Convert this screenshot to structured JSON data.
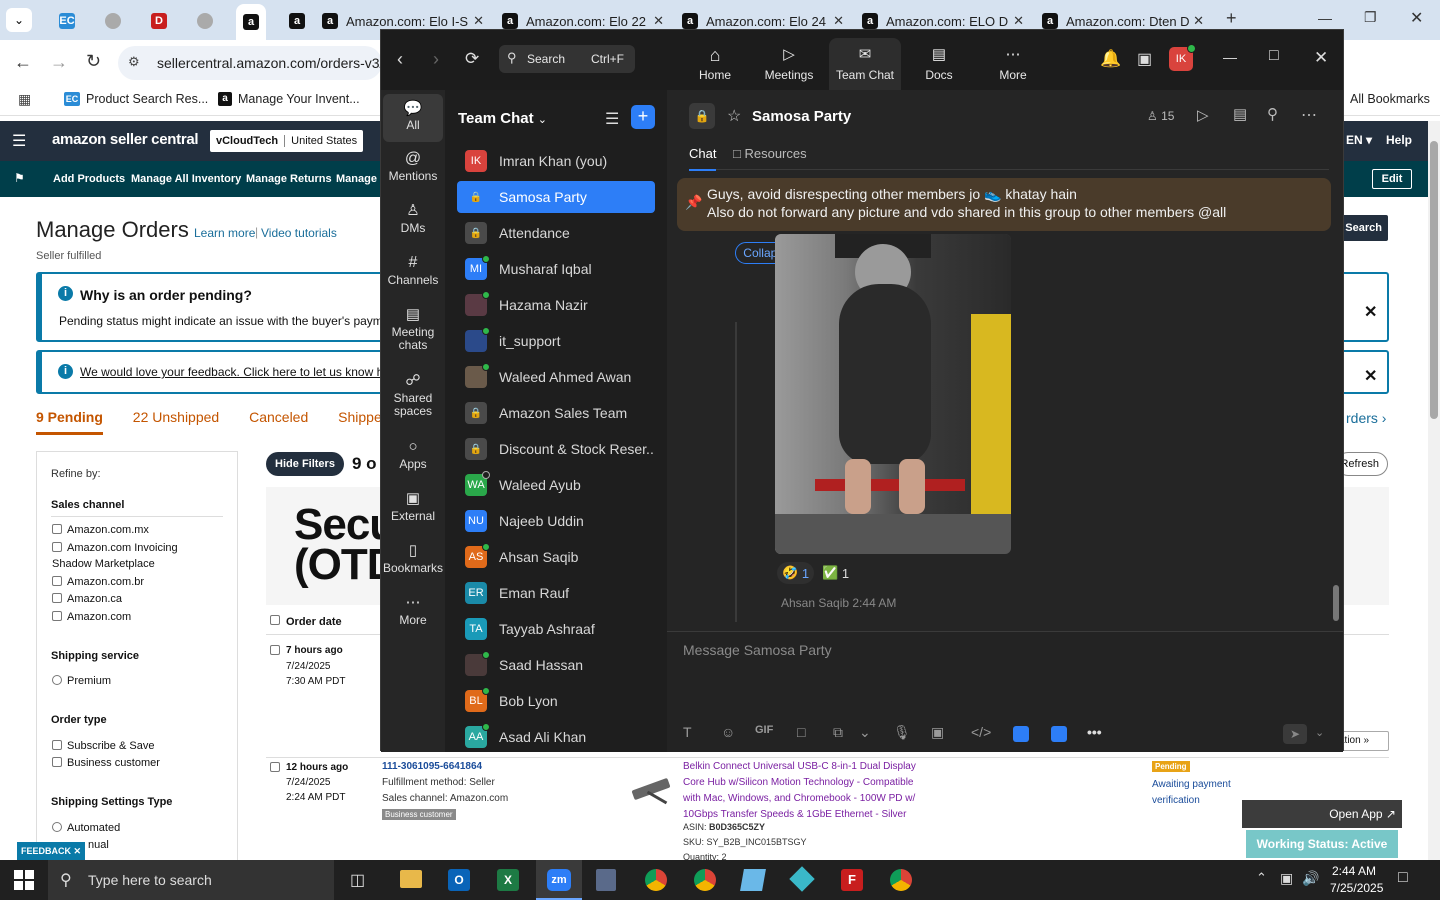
{
  "browser": {
    "tabs": [
      {
        "label": "",
        "icon": "ec-icon"
      },
      {
        "label": "",
        "icon": "generic-icon"
      },
      {
        "label": "",
        "icon": "dell-icon"
      },
      {
        "label": "",
        "icon": "generic-icon"
      },
      {
        "label": "",
        "icon": "amazon-icon"
      },
      {
        "label": "",
        "icon": "amazon-icon"
      },
      {
        "label": "Amazon.com: Elo I-S",
        "icon": "amazon-icon"
      },
      {
        "label": "Amazon.com: Elo 22",
        "icon": "amazon-icon"
      },
      {
        "label": "Amazon.com: Elo 24",
        "icon": "amazon-icon"
      },
      {
        "label": "Amazon.com: ELO D",
        "icon": "amazon-icon"
      },
      {
        "label": "Amazon.com: Dten D",
        "icon": "amazon-icon"
      }
    ],
    "url": "sellercentral.amazon.com/orders-v3/",
    "bookmarks": [
      "Product Search Res...",
      "Manage Your Invent..."
    ],
    "all_bookmarks": "All Bookmarks"
  },
  "seller": {
    "brand": "amazon seller central",
    "account": "vCloudTech",
    "marketplace": "United States",
    "lang": "EN",
    "help": "Help",
    "nav": [
      "Add Products",
      "Manage All Inventory",
      "Manage Returns",
      "Manage C"
    ],
    "edit": "Edit",
    "page_title": "Manage Orders",
    "learn_more": "Learn more",
    "video_tutorials": "Video tutorials",
    "fulfilled": "Seller fulfilled",
    "pending_title": "Why is an order pending?",
    "pending_text": "Pending status might indicate an issue with the buyer's paymen",
    "feedback_link": "We would love your feedback. Click here to let us know how",
    "search": "Search",
    "status_tabs": [
      "9 Pending",
      "22 Unshipped",
      "Canceled",
      "Shipped"
    ],
    "orders_link": "rders ›",
    "refine": "Refine by:",
    "sales_channel": "Sales channel",
    "channels": [
      "Amazon.com.mx",
      "Amazon.com Invoicing",
      "Shadow Marketplace",
      "Amazon.com.br",
      "Amazon.ca",
      "Amazon.com"
    ],
    "shipping_service": "Shipping service",
    "premium": "Premium",
    "order_type": "Order type",
    "order_types": [
      "Subscribe & Save",
      "Business customer"
    ],
    "ship_settings": "Shipping Settings Type",
    "ship_types": [
      "Automated",
      "nual"
    ],
    "hide_filters": "Hide Filters",
    "count": "9 o",
    "refresh": "Refresh",
    "banner": "Secu\n(OTD",
    "order_date": "Order date",
    "row1": {
      "ago": "7 hours ago",
      "date": "7/24/2025",
      "time": "7:30 AM PDT"
    },
    "row2": {
      "ago": "12 hours ago",
      "date": "7/24/2025",
      "time": "2:24 AM PDT",
      "order_id": "111-3061095-6641864",
      "method": "Fulfillment method: Seller",
      "channel": "Sales channel: Amazon.com",
      "badge": "Business customer",
      "product": "Belkin Connect Universal USB-C 8-in-1 Dual Display Core Hub w/Silicon Motion Technology - Compatible with Mac, Windows, and Chromebook - 100W PD w/ 10Gbps Transfer Speeds & 1GbE Ethernet - Silver",
      "asin_label": "ASIN:",
      "asin": "B0D365C5ZY",
      "sku": "SKU: SY_B2B_INC015BTSGY",
      "qty": "Quantity: 2",
      "status_badge": "Pending",
      "status_text": "Awaiting payment verification"
    },
    "action": "ation »",
    "feedback_tab": "FEEDBACK ✕",
    "open_app": "Open App ↗",
    "working_status": "Working Status: Active"
  },
  "zoom": {
    "search_label": "Search",
    "search_shortcut": "Ctrl+F",
    "nav": [
      {
        "label": "Home",
        "icon": "home-icon"
      },
      {
        "label": "Meetings",
        "icon": "video-icon"
      },
      {
        "label": "Team Chat",
        "icon": "chat-icon"
      },
      {
        "label": "Docs",
        "icon": "doc-icon"
      },
      {
        "label": "More",
        "icon": "more-icon"
      }
    ],
    "avatar": "IK",
    "rail": [
      "All",
      "Mentions",
      "DMs",
      "Channels",
      "Meeting chats",
      "Shared spaces",
      "Apps",
      "External",
      "Bookmarks",
      "More"
    ],
    "list_title": "Team Chat",
    "contacts": [
      {
        "name": "Imran Khan (you)",
        "avatar": "IK",
        "color": "#d9433d",
        "status": "none"
      },
      {
        "name": "Samosa Party",
        "avatar": "lock",
        "color": "#3a3a3a",
        "status": "none"
      },
      {
        "name": "Attendance",
        "avatar": "lock",
        "color": "#4a4a4a",
        "status": "none"
      },
      {
        "name": "Musharaf Iqbal",
        "avatar": "MI",
        "color": "#2d7ef7",
        "status": "online"
      },
      {
        "name": "Hazama Nazir",
        "avatar": "",
        "color": "#5a3a44",
        "status": "online"
      },
      {
        "name": "it_support",
        "avatar": "",
        "color": "#2b4a8a",
        "status": "online"
      },
      {
        "name": "Waleed Ahmed Awan",
        "avatar": "",
        "color": "#6a5a4a",
        "status": "online"
      },
      {
        "name": "Amazon Sales Team",
        "avatar": "lock",
        "color": "#4a4a4a",
        "status": "none"
      },
      {
        "name": "Discount & Stock Reser...",
        "avatar": "lock",
        "color": "#4a4a4a",
        "status": "none"
      },
      {
        "name": "Waleed Ayub",
        "avatar": "WA",
        "color": "#2aa84a",
        "status": "away"
      },
      {
        "name": "Najeeb Uddin",
        "avatar": "NU",
        "color": "#2d7ef7",
        "status": "none"
      },
      {
        "name": "Ahsan Saqib",
        "avatar": "AS",
        "color": "#e06a1a",
        "status": "online"
      },
      {
        "name": "Eman Rauf",
        "avatar": "ER",
        "color": "#1a8aa8",
        "status": "none"
      },
      {
        "name": "Tayyab Ashraaf",
        "avatar": "TA",
        "color": "#1a9ab8",
        "status": "none"
      },
      {
        "name": "Saad Hassan",
        "avatar": "",
        "color": "#4a3a3a",
        "status": "online"
      },
      {
        "name": "Bob Lyon",
        "avatar": "BL",
        "color": "#e06a1a",
        "status": "online"
      },
      {
        "name": "Asad Ali Khan",
        "avatar": "AA",
        "color": "#2aa8a0",
        "status": "online"
      }
    ],
    "channel_name": "Samosa Party",
    "members": "15",
    "tabs": [
      "Chat",
      "Resources"
    ],
    "pinned_line1": "Guys, avoid disrespecting other members jo 👟 khatay hain",
    "pinned_line2": "Also do not forward any picture and vdo shared in this group to other members @all",
    "collapse_all": "Collapse all ⌃",
    "reactions": [
      {
        "emoji": "🤣",
        "count": "1"
      },
      {
        "emoji": "✅",
        "count": "1"
      }
    ],
    "next_sender": "Ahsan Saqib 2:44 AM",
    "composer_placeholder": "Message Samosa Party",
    "toolbar": [
      "T",
      "☺",
      "GIF",
      "□",
      "⧉",
      "⌄",
      "🎙",
      "▣",
      "</>",
      "",
      "",
      "•••"
    ]
  },
  "taskbar": {
    "search": "Type here to search",
    "time": "2:44 AM",
    "date": "7/25/2025"
  }
}
